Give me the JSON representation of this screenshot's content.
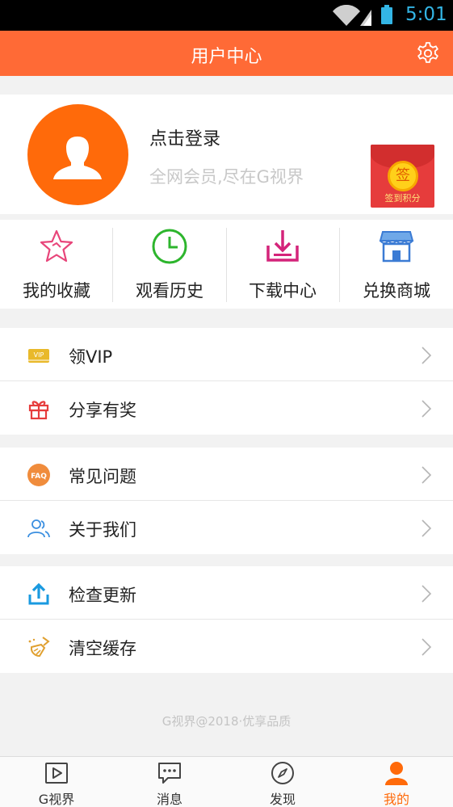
{
  "status_bar": {
    "time": "5:01"
  },
  "header": {
    "title": "用户中心",
    "settings_icon": "gear-icon"
  },
  "profile": {
    "login_label": "点击登录",
    "subtitle": "全网会员,尽在G视界",
    "signin_badge": {
      "coin_char": "签",
      "caption": "签到积分"
    }
  },
  "quick_actions": [
    {
      "label": "我的收藏",
      "icon": "star-icon"
    },
    {
      "label": "观看历史",
      "icon": "clock-icon"
    },
    {
      "label": "下载中心",
      "icon": "download-icon"
    },
    {
      "label": "兑换商城",
      "icon": "store-icon"
    }
  ],
  "menu_sections": [
    [
      {
        "label": "领VIP",
        "icon": "vip-card-icon"
      },
      {
        "label": "分享有奖",
        "icon": "gift-icon"
      }
    ],
    [
      {
        "label": "常见问题",
        "icon": "faq-icon",
        "icon_text": "FAQ"
      },
      {
        "label": "关于我们",
        "icon": "people-icon"
      }
    ],
    [
      {
        "label": "检查更新",
        "icon": "upload-icon"
      },
      {
        "label": "清空缓存",
        "icon": "broom-icon"
      }
    ]
  ],
  "vip_icon_text": "VIP",
  "footer": "G视界@2018·优享品质",
  "bottom_nav": [
    {
      "label": "G视界",
      "icon": "play-icon",
      "active": false
    },
    {
      "label": "消息",
      "icon": "message-icon",
      "active": false
    },
    {
      "label": "发现",
      "icon": "compass-icon",
      "active": false
    },
    {
      "label": "我的",
      "icon": "person-icon",
      "active": true
    }
  ],
  "colors": {
    "accent": "#ff6a36",
    "avatar": "#ff6a0a",
    "active_nav": "#ff6a0a"
  }
}
